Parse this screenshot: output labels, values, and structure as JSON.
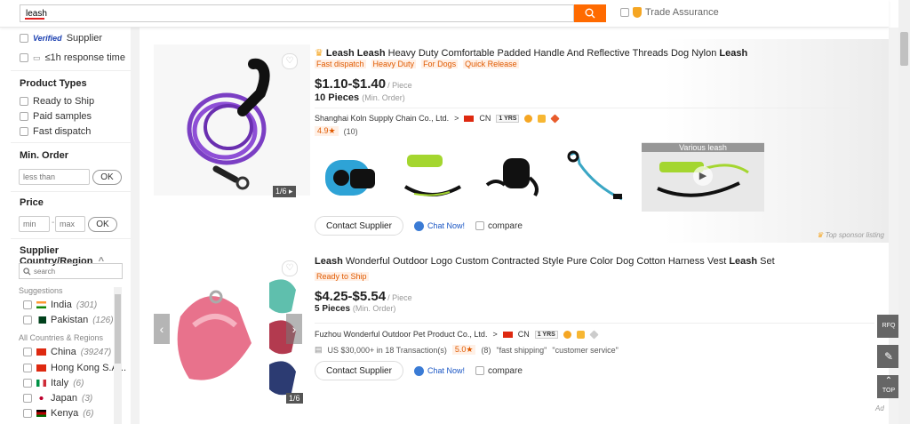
{
  "search": {
    "value": "leash"
  },
  "trade_assurance": {
    "label": "Trade Assurance"
  },
  "sidebar": {
    "verified_badge": "Verified",
    "supplier_label": "Supplier",
    "response_label": "≤1h response time",
    "product_types": {
      "heading": "Product Types",
      "options": [
        "Ready to Ship",
        "Paid samples",
        "Fast dispatch"
      ]
    },
    "min_order": {
      "heading": "Min. Order",
      "placeholder": "less than",
      "ok": "OK"
    },
    "price": {
      "heading": "Price",
      "min_placeholder": "min",
      "separator": "-",
      "max_placeholder": "max",
      "ok": "OK"
    },
    "country": {
      "heading": "Supplier Country/Region",
      "chevron": "^",
      "search_placeholder": "search",
      "suggestions_label": "Suggestions",
      "suggestions": [
        {
          "name": "India",
          "count": "(301)"
        },
        {
          "name": "Pakistan",
          "count": "(126)"
        }
      ],
      "all_label": "All Countries & Regions",
      "all": [
        {
          "name": "China",
          "count": "(39247)"
        },
        {
          "name": "Hong Kong S.A...",
          "count": ""
        },
        {
          "name": "Italy",
          "count": "(6)"
        },
        {
          "name": "Japan",
          "count": "(3)"
        },
        {
          "name": "Kenya",
          "count": "(6)"
        }
      ]
    }
  },
  "products": [
    {
      "title_parts": [
        {
          "text": "Leash Leash",
          "bold": true
        },
        {
          "text": " Heavy Duty Comfortable Padded Handle And Reflective Threads Dog Nylon ",
          "bold": false
        },
        {
          "text": "Leash",
          "bold": true
        }
      ],
      "tags": [
        "Fast dispatch",
        "Heavy Duty",
        "For Dogs",
        "Quick Release"
      ],
      "price": "$1.10-$1.40",
      "unit": "/ Piece",
      "moq": "10 Pieces",
      "moq_label": "(Min. Order)",
      "supplier": "Shanghai Koln Supply Chain Co., Ltd.",
      "supplier_arrow": ">",
      "country": "CN",
      "years": "1 YRS",
      "rating": "4.9★",
      "reviews": "(10)",
      "image_count": "1/6",
      "video_label": "Various leash",
      "contact": "Contact Supplier",
      "chat": "Chat Now!",
      "compare": "compare",
      "sponsor": "Top sponsor listing"
    },
    {
      "title_parts": [
        {
          "text": "Leash",
          "bold": true
        },
        {
          "text": " Wonderful Outdoor Logo Custom Contracted Style Pure Color Dog Cotton Harness Vest ",
          "bold": false
        },
        {
          "text": "Leash",
          "bold": true
        },
        {
          "text": " Set",
          "bold": false
        }
      ],
      "tags": [
        "Ready to Ship"
      ],
      "price": "$4.25-$5.54",
      "unit": "/ Piece",
      "moq": "5 Pieces",
      "moq_label": "(Min. Order)",
      "supplier": "Fuzhou Wonderful Outdoor Pet Product Co., Ltd.",
      "supplier_arrow": ">",
      "country": "CN",
      "years": "1 YRS",
      "transactions": "US $30,000+ in 18 Transaction(s)",
      "rating": "5.0★",
      "reviews": "(8)",
      "review_tags": [
        "\"fast shipping\"",
        "\"customer service\""
      ],
      "image_count": "1/6",
      "contact": "Contact Supplier",
      "chat": "Chat Now!",
      "compare": "compare"
    }
  ],
  "floating": {
    "rfq": "RFQ",
    "top": "TOP"
  },
  "ad_label": "Ad",
  "colors": {
    "accent": "#ff6a00",
    "link": "#1a56c4",
    "tag_text": "#e05a00"
  }
}
